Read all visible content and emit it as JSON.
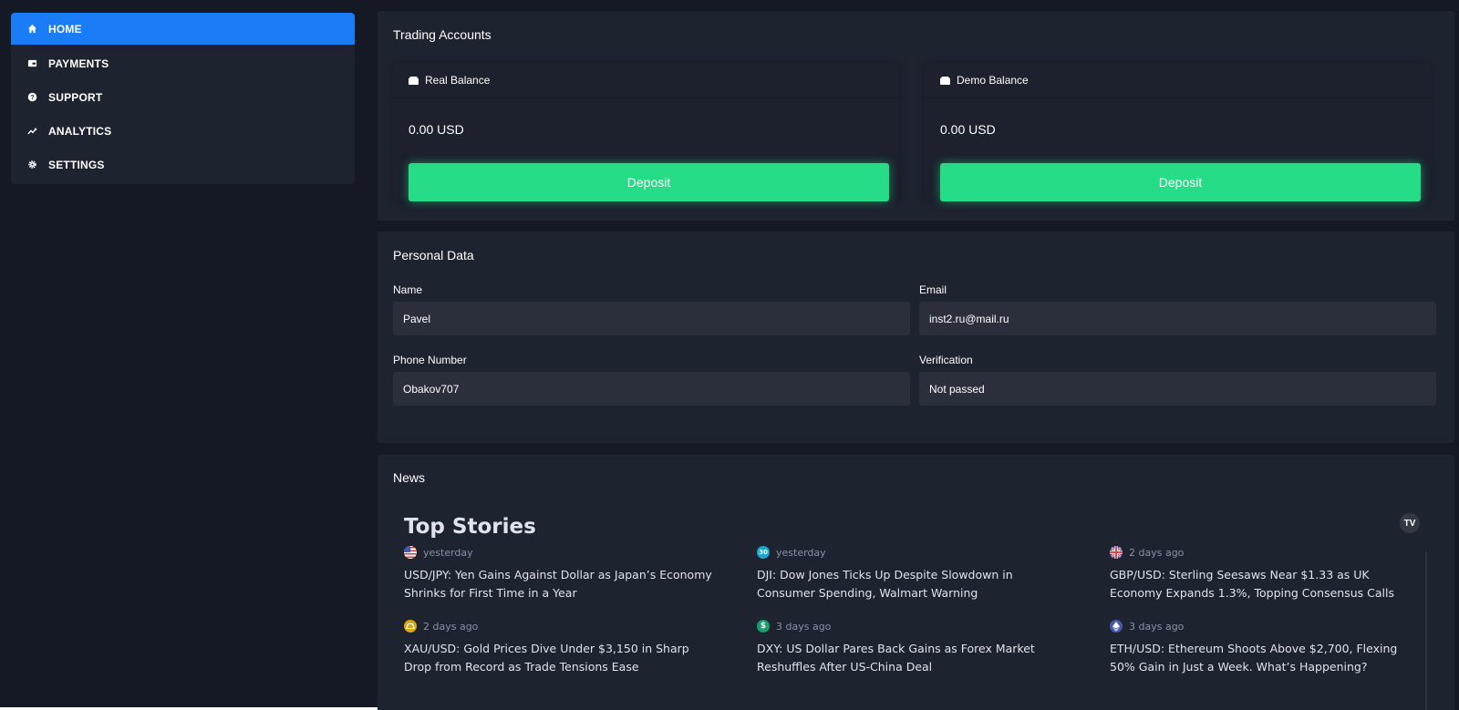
{
  "sidebar": {
    "items": [
      {
        "label": "HOME",
        "icon": "home-icon",
        "active": true
      },
      {
        "label": "PAYMENTS",
        "icon": "wallet-icon",
        "active": false
      },
      {
        "label": "SUPPORT",
        "icon": "help-icon",
        "active": false
      },
      {
        "label": "ANALYTICS",
        "icon": "trend-up-icon",
        "active": false
      },
      {
        "label": "SETTINGS",
        "icon": "gear-icon",
        "active": false
      }
    ]
  },
  "trading_accounts": {
    "title": "Trading Accounts",
    "real": {
      "label": "Real Balance",
      "value": "0.00 USD",
      "button": "Deposit"
    },
    "demo": {
      "label": "Demo Balance",
      "value": "0.00 USD",
      "button": "Deposit"
    }
  },
  "personal_data": {
    "title": "Personal Data",
    "name_label": "Name",
    "name_value": "Pavel",
    "email_label": "Email",
    "email_value": "inst2.ru@mail.ru",
    "phone_label": "Phone Number",
    "phone_value": "Obakov707",
    "verification_label": "Verification",
    "verification_value": "Not passed"
  },
  "news": {
    "title": "News",
    "widget_title": "Top Stories",
    "widget_logo": "TV",
    "stories": [
      {
        "time": "yesterday",
        "icon": "us-flag-icon",
        "headline": "USD/JPY: Yen Gains Against Dollar as Japan’s Economy Shrinks for First Time in a Year"
      },
      {
        "time": "yesterday",
        "icon": "dji-30-icon",
        "badge": "30",
        "headline": "DJI: Dow Jones Ticks Up Despite Slowdown in Consumer Spending, Walmart Warning"
      },
      {
        "time": "2 days ago",
        "icon": "uk-flag-icon",
        "headline": "GBP/USD: Sterling Seesaws Near $1.33 as UK Economy Expands 1.3%, Topping Consensus Calls"
      },
      {
        "time": "2 days ago",
        "icon": "gold-icon",
        "headline": "XAU/USD: Gold Prices Dive Under $3,150 in Sharp Drop from Record as Trade Tensions Ease"
      },
      {
        "time": "3 days ago",
        "icon": "dollar-icon",
        "badge": "$",
        "headline": "DXY: US Dollar Pares Back Gains as Forex Market Reshuffles After US-China Deal"
      },
      {
        "time": "3 days ago",
        "icon": "ethereum-icon",
        "headline": "ETH/USD: Ethereum Shoots Above $2,700, Flexing 50% Gain in Just a Week. What’s Happening?"
      }
    ]
  },
  "colors": {
    "accent": "#1a7cf6",
    "deposit": "#27dc86",
    "panel": "#1e2330",
    "background": "#141925"
  }
}
